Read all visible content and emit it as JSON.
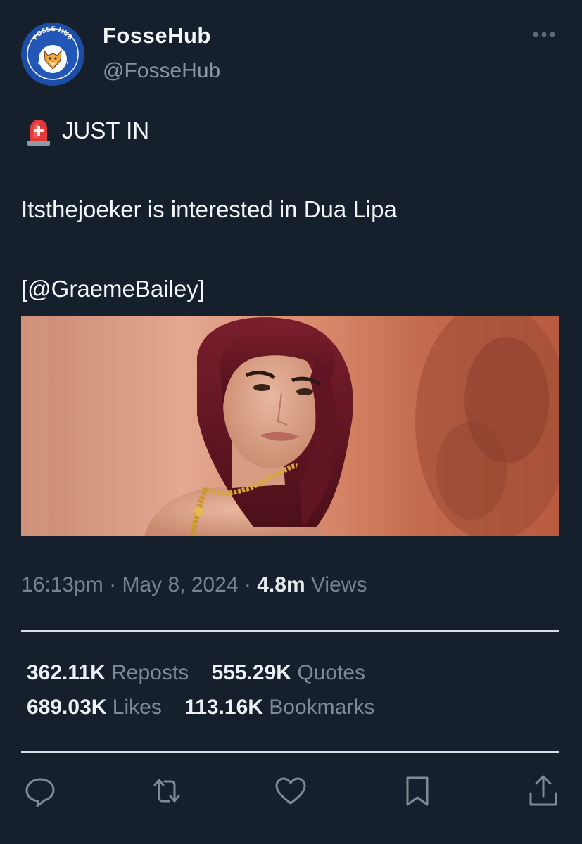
{
  "author": {
    "display_name": "FosseHub",
    "handle": "@FosseHub",
    "avatar_logo_text": "FOSSE HUB"
  },
  "menu": {
    "more_icon": "more-horizontal-icon"
  },
  "tweet": {
    "badge_icon": "siren-emoji",
    "line1": "JUST IN",
    "line2": "Itsthejoeker is interested in Dua Lipa",
    "line3": "[@GraemeBailey]"
  },
  "meta": {
    "time": "16:13pm",
    "date": "May 8, 2024",
    "views_count": "4.8m",
    "views_label": "Views",
    "separator": "·"
  },
  "stats": {
    "reposts": {
      "count": "362.11K",
      "label": "Reposts"
    },
    "quotes": {
      "count": "555.29K",
      "label": "Quotes"
    },
    "likes": {
      "count": "689.03K",
      "label": "Likes"
    },
    "bookmarks": {
      "count": "113.16K",
      "label": "Bookmarks"
    }
  },
  "actions": [
    "reply-icon",
    "repost-icon",
    "like-icon",
    "bookmark-icon",
    "share-icon"
  ],
  "colors": {
    "background": "#16202c",
    "primary_text": "#f1f3f5",
    "secondary_text": "#7f8a95",
    "divider": "#d9dde1"
  }
}
